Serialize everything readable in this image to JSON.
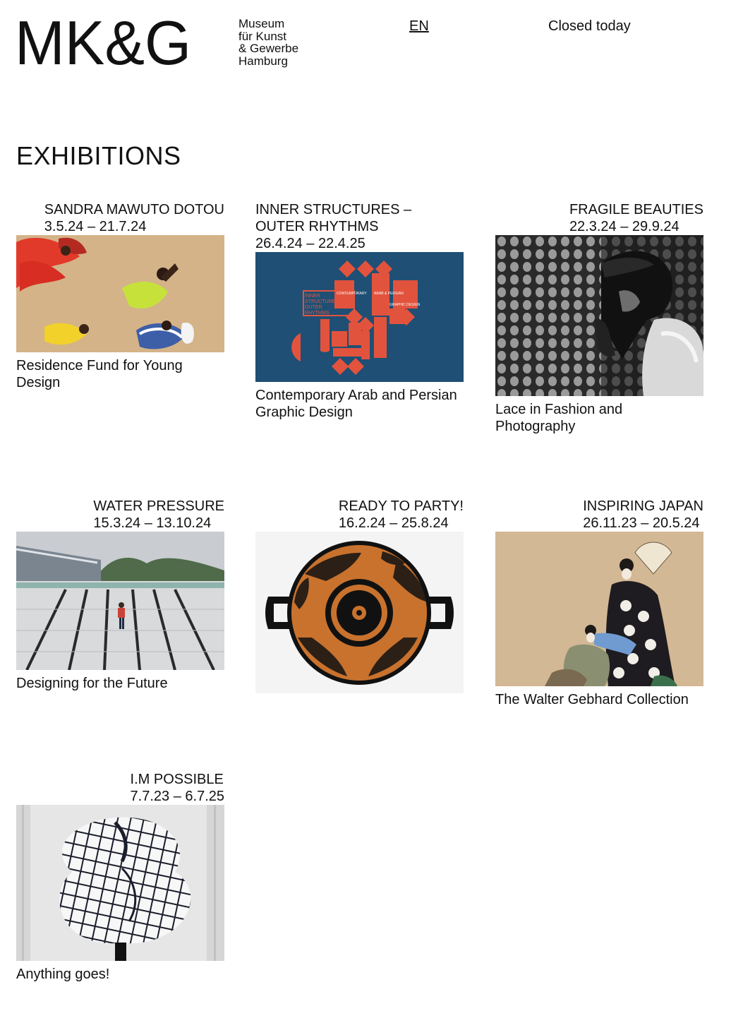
{
  "header": {
    "logo_text": "MK&G",
    "museum_name": [
      "Museum",
      "für Kunst",
      "& Gewerbe",
      "Hamburg"
    ],
    "language": "EN",
    "opening_status": "Closed today"
  },
  "page": {
    "title": "EXHIBITIONS"
  },
  "exhibitions": [
    {
      "title": "SANDRA MAWUTO DOTOU",
      "dates": "3.5.24 – 21.7.24",
      "subtitle": "Residence Fund for Young Design"
    },
    {
      "title": "INNER STRUCTURES – OUTER RHYTHMS",
      "dates": "26.4.24 – 22.4.25",
      "subtitle": "Contemporary Arab and Persian Graphic Design",
      "poster_lines": [
        "INNER",
        "STRUCTURES—",
        "OUTER",
        "RHYTHMS",
        "CONTEMPORARY",
        "ARAB & PERSIAN",
        "GRAPHIC DESIGN"
      ]
    },
    {
      "title": "FRAGILE BEAUTIES",
      "dates": "22.3.24 – 29.9.24",
      "subtitle": "Lace in Fashion and Photography"
    },
    {
      "title": "WATER PRESSURE",
      "dates": "15.3.24 – 13.10.24",
      "subtitle": "Designing for the Future"
    },
    {
      "title": "READY TO PARTY!",
      "dates": "16.2.24 – 25.8.24",
      "subtitle": ""
    },
    {
      "title": "INSPIRING JAPAN",
      "dates": "26.11.23 – 20.5.24",
      "subtitle": "The Walter Gebhard Collection"
    },
    {
      "title": "I.M POSSIBLE",
      "dates": "7.7.23 – 6.7.25",
      "subtitle": "Anything goes!"
    }
  ],
  "colors": {
    "poster_blue": "#1f4f74",
    "poster_red": "#e2533d",
    "text": "#111111"
  }
}
